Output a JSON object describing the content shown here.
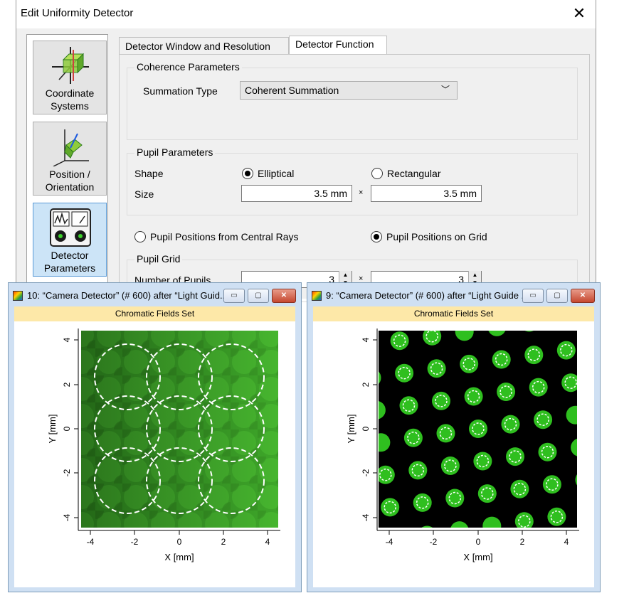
{
  "dialog": {
    "title": "Edit Uniformity Detector",
    "close_icon": "close-icon",
    "nav": [
      {
        "label1": "Coordinate",
        "label2": "Systems",
        "icon": "coordinate-systems-icon"
      },
      {
        "label1": "Position /",
        "label2": "Orientation",
        "icon": "position-orientation-icon"
      },
      {
        "label1": "Detector",
        "label2": "Parameters",
        "icon": "detector-parameters-icon"
      }
    ],
    "tabs": [
      "Detector Window and Resolution",
      "Detector Function"
    ],
    "coherence": {
      "title": "Coherence Parameters",
      "summation_label": "Summation Type",
      "summation_value": "Coherent Summation"
    },
    "pupil": {
      "title": "Pupil Parameters",
      "shape_label": "Shape",
      "shape_elliptical": "Elliptical",
      "shape_rectangular": "Rectangular",
      "size_label": "Size",
      "size_x": "3.5 mm",
      "size_y": "3.5 mm",
      "times": "×"
    },
    "positions": {
      "central": "Pupil Positions from Central Rays",
      "grid": "Pupil Positions on Grid"
    },
    "grid": {
      "title": "Pupil Grid",
      "count_label": "Number of Pupils",
      "count_x": "3",
      "count_y": "3",
      "times": "×"
    }
  },
  "windows": [
    {
      "title": "10: “Camera Detector” (# 600) after “Light Guid...",
      "band": "Chromatic Fields Set",
      "xlabel": "X [mm]",
      "ylabel": "Y [mm]",
      "xticks": [
        "-4",
        "-2",
        "0",
        "2",
        "4"
      ],
      "yticks": [
        "4",
        "2",
        "0",
        "-2",
        "-4"
      ],
      "buttons": [
        "minimize-icon",
        "maximize-icon",
        "close-icon"
      ]
    },
    {
      "title": "9: “Camera Detector” (# 600) after “Light Guide ...",
      "band": "Chromatic Fields Set",
      "xlabel": "X [mm]",
      "ylabel": "Y [mm]",
      "xticks": [
        "-4",
        "-2",
        "0",
        "2",
        "4"
      ],
      "yticks": [
        "4",
        "2",
        "0",
        "-2",
        "-4"
      ],
      "buttons": [
        "minimize-icon",
        "maximize-icon",
        "close-icon"
      ]
    }
  ],
  "colors": {
    "accent_select": "#cce4f7",
    "band": "#fde8a8",
    "field_green": "#2fbf1f"
  }
}
